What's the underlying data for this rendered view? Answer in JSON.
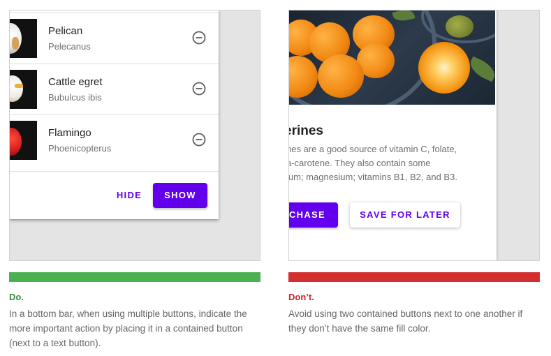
{
  "do_example": {
    "items": [
      {
        "title": "Pelican",
        "subtitle": "Pelecanus"
      },
      {
        "title": "Cattle egret",
        "subtitle": "Bubulcus ibis"
      },
      {
        "title": "Flamingo",
        "subtitle": "Phoenicopterus"
      }
    ],
    "hide_label": "HIDE",
    "show_label": "SHOW"
  },
  "dont_example": {
    "card_title": "erines",
    "card_body_lines": [
      "nes are a good source of vitamin C, folate,",
      "a-carotene. They also contain some",
      "ium; magnesium; vitamins B1, B2, and B3."
    ],
    "purchase_label": "CHASE",
    "save_label": "SAVE FOR LATER"
  },
  "captions": {
    "do": {
      "label": "Do.",
      "text": "In a bottom bar, when using multiple buttons, indicate the more important action by placing it in a contained button (next to a text button).",
      "color": "#4caf50"
    },
    "dont": {
      "label": "Don’t.",
      "text": "Avoid using two contained buttons next to one another if they don’t have the same fill color.",
      "color": "#d32f2f"
    }
  },
  "colors": {
    "primary": "#6200ee",
    "panel_bg": "#e4e4e4",
    "do_green": "#4caf50",
    "dont_red": "#d32f2f"
  }
}
